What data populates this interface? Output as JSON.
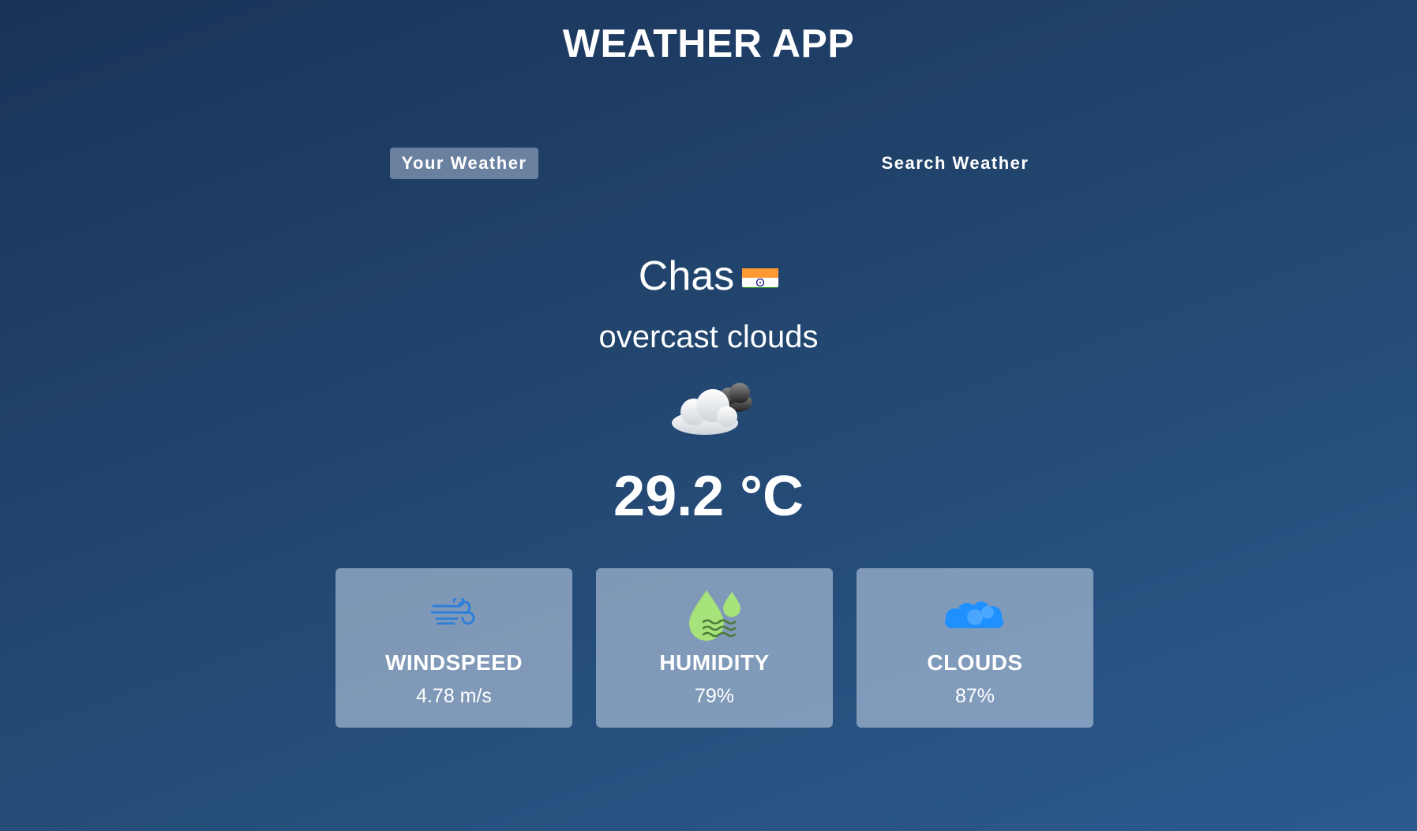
{
  "header": {
    "title": "WEATHER APP"
  },
  "tabs": [
    {
      "label": "Your Weather",
      "active": true
    },
    {
      "label": "Search Weather",
      "active": false
    }
  ],
  "location": {
    "city": "Chas",
    "flag_icon": "india-flag-icon"
  },
  "weather": {
    "description": "overcast clouds",
    "icon": "overcast-clouds-icon",
    "temperature": "29.2 °C"
  },
  "stats": [
    {
      "label": "WINDSPEED",
      "value": "4.78 m/s",
      "icon": "wind-icon"
    },
    {
      "label": "HUMIDITY",
      "value": "79%",
      "icon": "humidity-icon"
    },
    {
      "label": "CLOUDS",
      "value": "87%",
      "icon": "clouds-icon"
    }
  ],
  "colors": {
    "background_top": "#1a3358",
    "background_bottom": "#2c5a8e",
    "card_background": "#b8c8de",
    "wind_icon": "#2e7fd9",
    "humidity_icon": "#a6e37a",
    "clouds_icon": "#1e90ff"
  }
}
